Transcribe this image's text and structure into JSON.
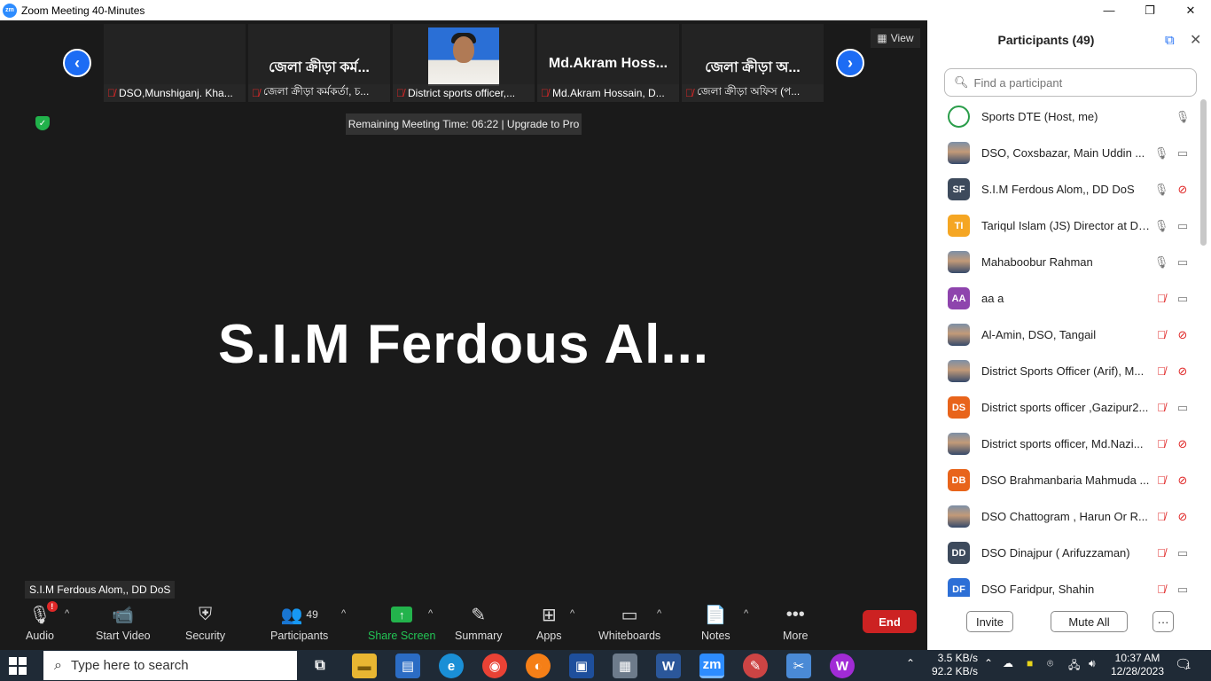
{
  "window": {
    "title": "Zoom Meeting 40-Minutes",
    "logo": "zm",
    "controls": [
      "—",
      "❐",
      "✕"
    ]
  },
  "strip": {
    "tiles": [
      {
        "name": "",
        "label": "DSO,Munshiganj. Kha..."
      },
      {
        "name": "জেলা ক্রীড়া কর্ম...",
        "label": "জেলা ক্রীড়া কর্মকর্তা, চ..."
      },
      {
        "name": "",
        "label": "District sports officer,...",
        "has_photo": true
      },
      {
        "name": "Md.Akram  Hoss...",
        "label": "Md.Akram Hossain, D..."
      },
      {
        "name": "জেলা ক্রীড়া অ...",
        "label": "জেলা ক্রীড়া অফিস (প..."
      }
    ],
    "view_label": "View"
  },
  "meeting": {
    "remaining_time": "Remaining Meeting Time: 06:22 | Upgrade to Pro",
    "active_speaker": "S.I.M  Ferdous  Al...",
    "speaker_label": "S.I.M Ferdous Alom,, DD DoS"
  },
  "toolbar": {
    "audio": "Audio",
    "start_video": "Start Video",
    "security": "Security",
    "participants": "Participants",
    "participants_count": "49",
    "share_screen": "Share Screen",
    "summary": "Summary",
    "apps": "Apps",
    "whiteboards": "Whiteboards",
    "notes": "Notes",
    "more": "More",
    "end": "End",
    "audio_badge": "!"
  },
  "panel": {
    "title": "Participants (49)",
    "search_placeholder": "Find a participant",
    "participants": [
      {
        "name": "Sports DTE (Host, me)",
        "avatar": "",
        "color": "#ffffff",
        "mic": "on",
        "cam": "none"
      },
      {
        "name": "DSO, Coxsbazar, Main Uddin ...",
        "avatar": "",
        "color": "photo",
        "mic": "on",
        "cam": "on"
      },
      {
        "name": "S.I.M Ferdous Alom,, DD DoS",
        "avatar": "SF",
        "color": "#3d4a5c",
        "mic": "on",
        "cam": "off"
      },
      {
        "name": "Tariqul Islam (JS) Director at DoS",
        "avatar": "TI",
        "color": "#f5a623",
        "mic": "on",
        "cam": "on"
      },
      {
        "name": "Mahaboobur Rahman",
        "avatar": "",
        "color": "photo",
        "mic": "on",
        "cam": "on"
      },
      {
        "name": "aa a",
        "avatar": "AA",
        "color": "#8e44ad",
        "mic": "off",
        "cam": "on"
      },
      {
        "name": "Al-Amin, DSO, Tangail",
        "avatar": "",
        "color": "photo",
        "mic": "off",
        "cam": "off"
      },
      {
        "name": "District Sports Officer (Arif), M...",
        "avatar": "",
        "color": "photo",
        "mic": "off",
        "cam": "off"
      },
      {
        "name": "District sports officer ,Gazipur2...",
        "avatar": "DS",
        "color": "#e8641b",
        "mic": "off",
        "cam": "on"
      },
      {
        "name": "District sports officer, Md.Nazi...",
        "avatar": "",
        "color": "photo",
        "mic": "off",
        "cam": "off"
      },
      {
        "name": "DSO Brahmanbaria Mahmuda ...",
        "avatar": "DB",
        "color": "#e8641b",
        "mic": "off",
        "cam": "off"
      },
      {
        "name": "DSO Chattogram , Harun Or R...",
        "avatar": "",
        "color": "photo",
        "mic": "off",
        "cam": "off"
      },
      {
        "name": "DSO Dinajpur ( Arifuzzaman)",
        "avatar": "DD",
        "color": "#3d4a5c",
        "mic": "off",
        "cam": "on"
      },
      {
        "name": "DSO Faridpur, Shahin",
        "avatar": "DF",
        "color": "#2d6fd6",
        "mic": "off",
        "cam": "on"
      }
    ],
    "invite": "Invite",
    "mute_all": "Mute All",
    "more": "···"
  },
  "taskbar": {
    "search_placeholder": "Type here to search",
    "net_up": "3.5 KB/s",
    "net_down": "92.2 KB/s",
    "time": "10:37 AM",
    "date": "12/28/2023",
    "notif_count": "1",
    "zoom_label": "zm"
  }
}
